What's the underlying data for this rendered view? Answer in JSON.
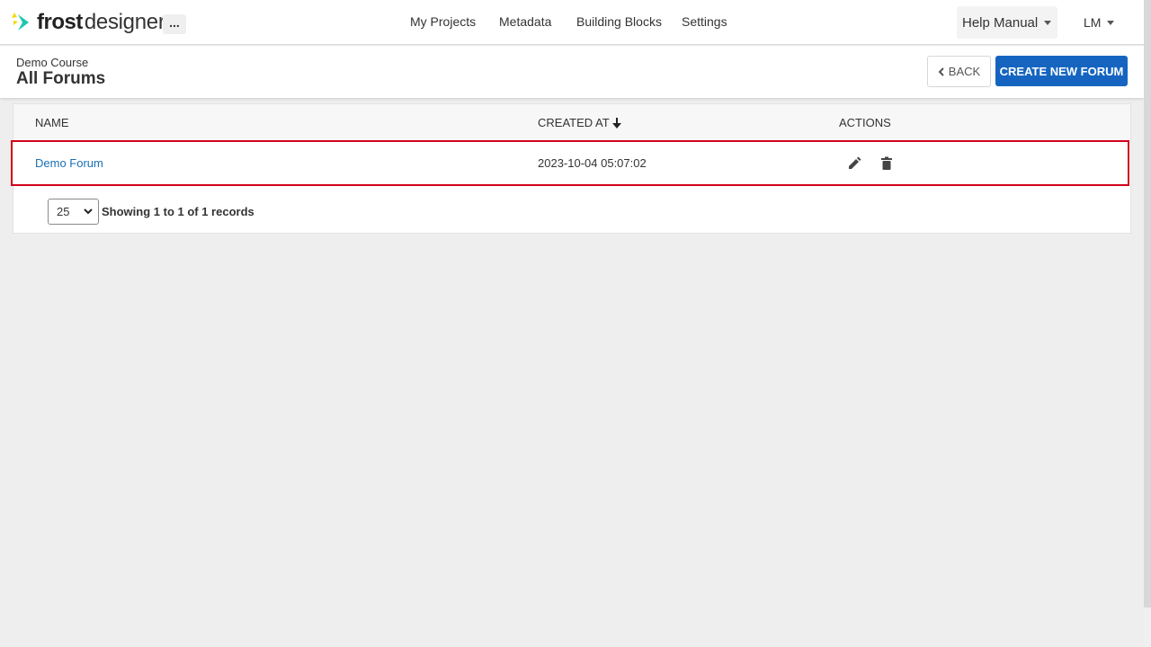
{
  "app": {
    "logo_brand": "frost",
    "logo_product": "designer",
    "more_label": "...",
    "colors": {
      "accent": "#1565c0",
      "highlight": "#d0021b",
      "link": "#1a6fb5",
      "logo_teal": "#1fc7b0",
      "logo_yellow": "#f5d80f"
    }
  },
  "nav": {
    "links": [
      "My Projects",
      "Metadata",
      "Building Blocks",
      "Settings"
    ],
    "help_label": "Help Manual",
    "user_initials": "LM"
  },
  "header": {
    "course": "Demo Course",
    "title": "All Forums",
    "back_label": "BACK",
    "create_label": "CREATE NEW FORUM"
  },
  "table": {
    "columns": [
      "NAME",
      "CREATED AT",
      "ACTIONS"
    ],
    "sort_icon": "arrow-down-icon",
    "rows": [
      {
        "name": "Demo Forum",
        "created_at": "2023-10-04 05:07:02",
        "actions": [
          "edit-icon",
          "delete-icon"
        ]
      }
    ]
  },
  "pager": {
    "page_size": "25",
    "showing": "Showing 1 to 1 of 1 records"
  }
}
